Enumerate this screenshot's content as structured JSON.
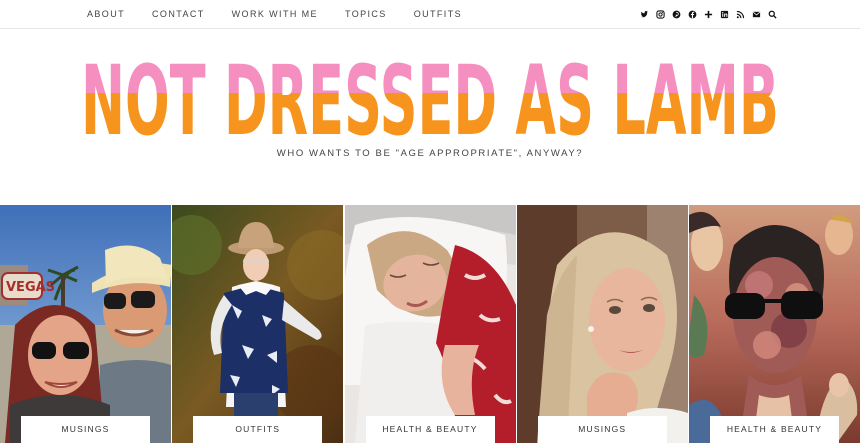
{
  "nav": {
    "items": [
      {
        "label": "ABOUT"
      },
      {
        "label": "CONTACT"
      },
      {
        "label": "WORK WITH ME"
      },
      {
        "label": "TOPICS"
      },
      {
        "label": "OUTFITS"
      }
    ]
  },
  "social": {
    "icons": [
      "twitter-icon",
      "instagram-icon",
      "pinterest-icon",
      "facebook-icon",
      "bloglovin-icon",
      "linkedin-icon",
      "rss-icon",
      "email-icon",
      "search-icon"
    ]
  },
  "header": {
    "logo_text": "NOT DRESSED AS LAMB",
    "tagline": "WHO WANTS TO BE \"AGE APPROPRIATE\", ANYWAY?",
    "colors": {
      "logo_top": "#f58fc0",
      "logo_bottom": "#f7941d"
    }
  },
  "featured": [
    {
      "category": "MUSINGS"
    },
    {
      "category": "OUTFITS"
    },
    {
      "category": "HEALTH & BEAUTY"
    },
    {
      "category": "MUSINGS"
    },
    {
      "category": "HEALTH & BEAUTY"
    }
  ]
}
